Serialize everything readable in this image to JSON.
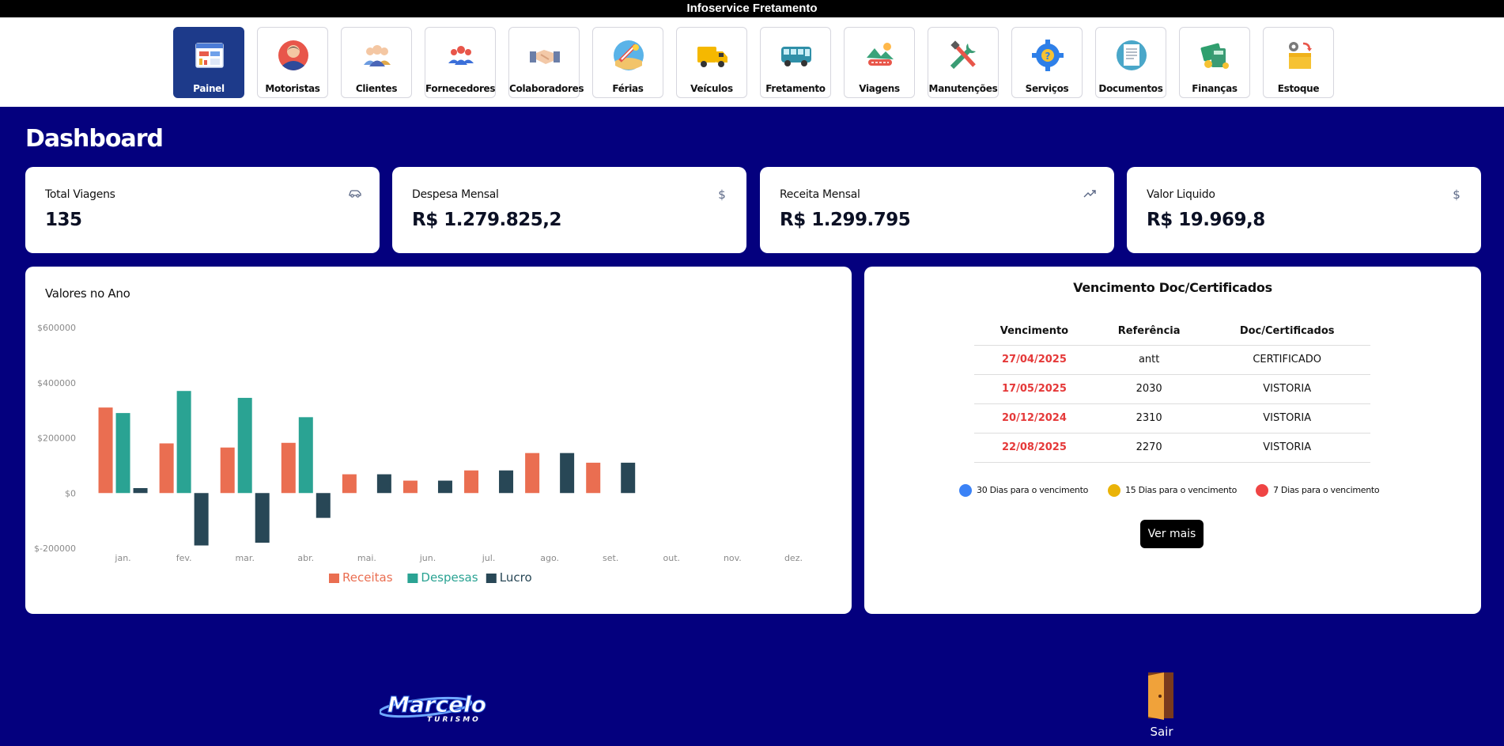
{
  "app": {
    "title": "Infoservice Fretamento"
  },
  "nav": [
    {
      "label": "Painel",
      "icon": "dashboard-icon",
      "active": true
    },
    {
      "label": "Motoristas",
      "icon": "driver-icon"
    },
    {
      "label": "Clientes",
      "icon": "clients-icon"
    },
    {
      "label": "Fornecedores",
      "icon": "suppliers-icon"
    },
    {
      "label": "Colaboradores",
      "icon": "handshake-icon"
    },
    {
      "label": "Férias",
      "icon": "beach-icon"
    },
    {
      "label": "Veículos",
      "icon": "truck-icon"
    },
    {
      "label": "Fretamento",
      "icon": "bus-icon"
    },
    {
      "label": "Viagens",
      "icon": "trip-icon"
    },
    {
      "label": "Manutenções",
      "icon": "tools-icon"
    },
    {
      "label": "Serviços",
      "icon": "gear-icon"
    },
    {
      "label": "Documentos",
      "icon": "documents-icon"
    },
    {
      "label": "Finanças",
      "icon": "finance-icon"
    },
    {
      "label": "Estoque",
      "icon": "stock-box-icon"
    }
  ],
  "page": {
    "title": "Dashboard"
  },
  "stats": [
    {
      "label": "Total Viagens",
      "value": "135",
      "icon": "car-icon"
    },
    {
      "label": "Despesa Mensal",
      "value": "R$ 1.279.825,2",
      "icon": "dollar-icon"
    },
    {
      "label": "Receita Mensal",
      "value": "R$ 1.299.795",
      "icon": "trending-up-icon"
    },
    {
      "label": "Valor Liquido",
      "value": "R$ 19.969,8",
      "icon": "dollar-icon"
    }
  ],
  "chart_data": {
    "type": "bar",
    "title": "Valores no Ano",
    "categories": [
      "jan.",
      "fev.",
      "mar.",
      "abr.",
      "mai.",
      "jun.",
      "jul.",
      "ago.",
      "set.",
      "out.",
      "nov.",
      "dez."
    ],
    "series": [
      {
        "name": "Receitas",
        "color": "#ea6e51",
        "values": [
          310000,
          180000,
          165000,
          182000,
          68000,
          45000,
          82000,
          145000,
          110000,
          null,
          null,
          null
        ]
      },
      {
        "name": "Despesas",
        "color": "#2aa393",
        "values": [
          290000,
          370000,
          345000,
          275000,
          null,
          null,
          null,
          null,
          null,
          null,
          null,
          null
        ]
      },
      {
        "name": "Lucro",
        "color": "#284756",
        "values": [
          18000,
          -190000,
          -180000,
          -90000,
          68000,
          45000,
          82000,
          145000,
          110000,
          null,
          null,
          null
        ]
      }
    ],
    "yticks": [
      {
        "value": 600000,
        "label": "$600000"
      },
      {
        "value": 400000,
        "label": "$400000"
      },
      {
        "value": 200000,
        "label": "$200000"
      },
      {
        "value": 0,
        "label": "$0"
      },
      {
        "value": -200000,
        "label": "$-200000"
      }
    ],
    "ylim": [
      -200000,
      600000
    ],
    "legend_position": "bottom"
  },
  "docs": {
    "title": "Vencimento Doc/Certificados",
    "headers": [
      "Vencimento",
      "Referência",
      "Doc/Certificados"
    ],
    "rows": [
      [
        "27/04/2025",
        "antt",
        "CERTIFICADO"
      ],
      [
        "17/05/2025",
        "2030",
        "VISTORIA"
      ],
      [
        "20/12/2024",
        "2310",
        "VISTORIA"
      ],
      [
        "22/08/2025",
        "2270",
        "VISTORIA"
      ]
    ],
    "legend": [
      {
        "label": "30 Dias para o vencimento",
        "color": "#3b82f6"
      },
      {
        "label": "15 Dias para o vencimento",
        "color": "#eab308"
      },
      {
        "label": "7 Dias para o vencimento",
        "color": "#ef4444"
      }
    ],
    "due_color": "#e53939",
    "more_label": "Ver mais"
  },
  "footer": {
    "logo_text": "Marcelo",
    "logo_sub": "TURISMO",
    "exit_label": "Sair"
  }
}
